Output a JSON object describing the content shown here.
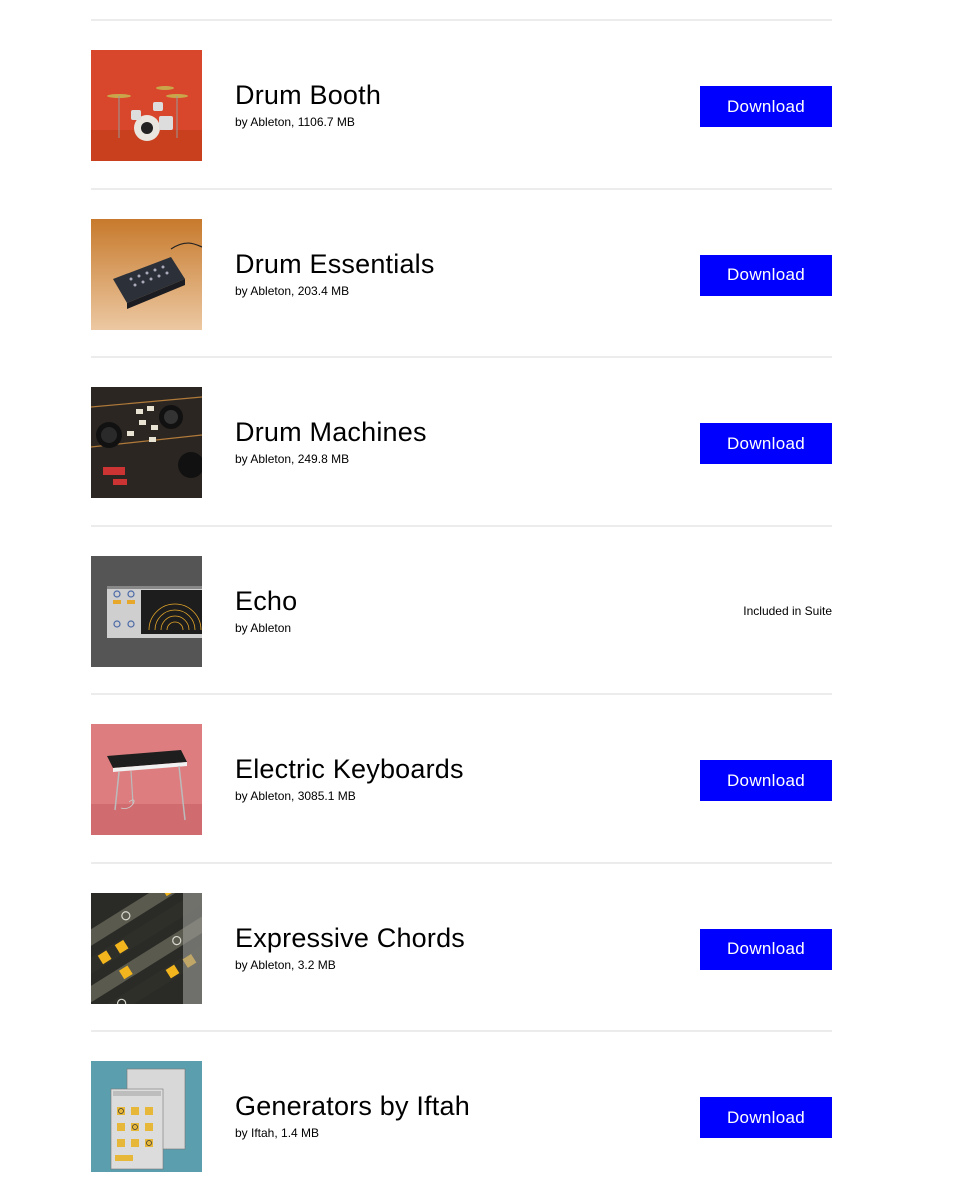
{
  "packs": [
    {
      "title": "Drum Booth",
      "meta": "by Ableton, 1106.7 MB",
      "action": "Download",
      "thumb": "drum-kit-image"
    },
    {
      "title": "Drum Essentials",
      "meta": "by Ableton, 203.4 MB",
      "action": "Download",
      "thumb": "drum-machine-image"
    },
    {
      "title": "Drum Machines",
      "meta": "by Ableton, 249.8 MB",
      "action": "Download",
      "thumb": "synth-knobs-image"
    },
    {
      "title": "Echo",
      "meta": "by Ableton",
      "status": "Included in Suite",
      "thumb": "echo-device-image"
    },
    {
      "title": "Electric Keyboards",
      "meta": "by Ableton, 3085.1 MB",
      "action": "Download",
      "thumb": "electric-piano-image"
    },
    {
      "title": "Expressive Chords",
      "meta": "by Ableton, 3.2 MB",
      "action": "Download",
      "thumb": "chord-device-image"
    },
    {
      "title": "Generators by Iftah",
      "meta": "by Iftah, 1.4 MB",
      "action": "Download",
      "thumb": "generator-device-image"
    }
  ],
  "colors": {
    "button": "#0000ff",
    "button_text": "#ffffff",
    "divider": "#ececec"
  }
}
